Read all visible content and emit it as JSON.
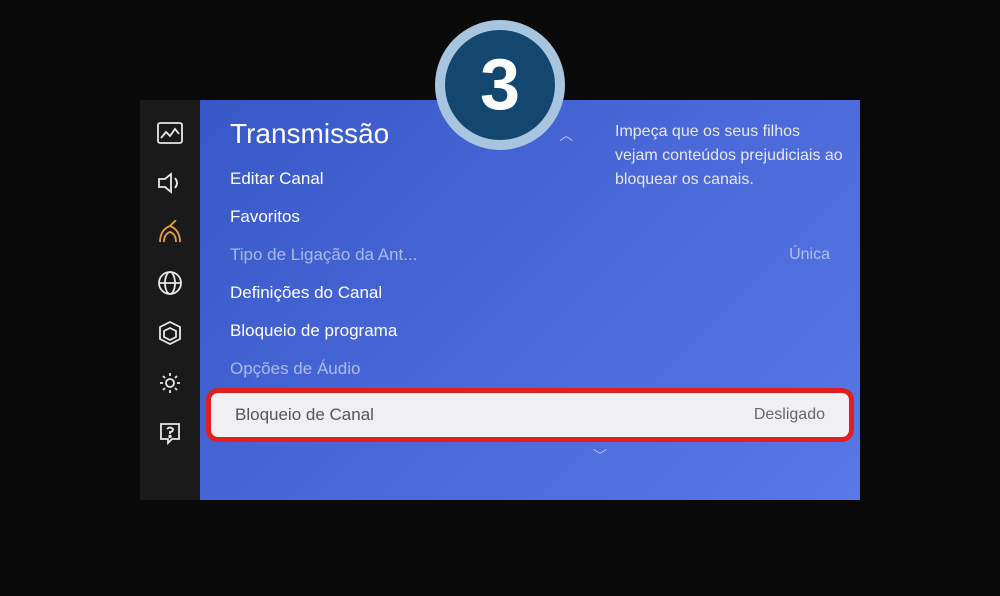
{
  "step_number": "3",
  "panel": {
    "title": "Transmissão",
    "scroll_up": "︿",
    "scroll_down": "﹀",
    "items": [
      {
        "label": "Editar Canal",
        "value": "",
        "dimmed": false
      },
      {
        "label": "Favoritos",
        "value": "",
        "dimmed": false
      },
      {
        "label": "Tipo de Ligação da Ant...",
        "value": "Única",
        "dimmed": true
      },
      {
        "label": "Definições do Canal",
        "value": "",
        "dimmed": false
      },
      {
        "label": "Bloqueio de programa",
        "value": "",
        "dimmed": false
      },
      {
        "label": "Opções de Áudio",
        "value": "",
        "dimmed": true
      },
      {
        "label": "Bloqueio de Canal",
        "value": "Desligado",
        "highlighted": true
      }
    ]
  },
  "help_text": "Impeça que os seus filhos vejam conteúdos prejudiciais ao bloquear os canais.",
  "sidebar": {
    "icons": [
      "picture",
      "sound",
      "broadcast",
      "network",
      "system",
      "general",
      "support"
    ]
  }
}
